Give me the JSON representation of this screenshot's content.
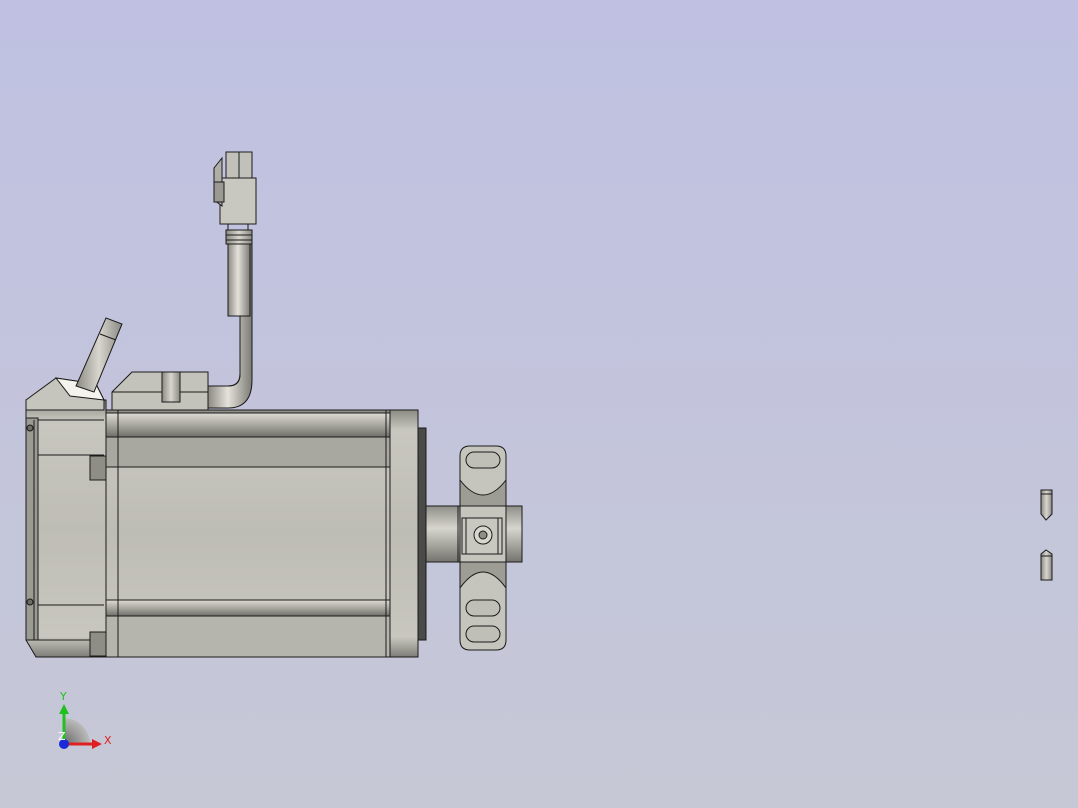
{
  "viewport": {
    "background_top": "#c0c1e2",
    "background_bottom": "#c6c8d6"
  },
  "model": {
    "part_fill": "#bfbeb6",
    "part_shade": "#8e8d86",
    "edge_color": "#1a1a1a"
  },
  "triad": {
    "x_label": "X",
    "y_label": "Y",
    "z_label": "Z",
    "x_color": "#e02020",
    "y_color": "#20c020",
    "z_color": "#1a2ad8"
  }
}
